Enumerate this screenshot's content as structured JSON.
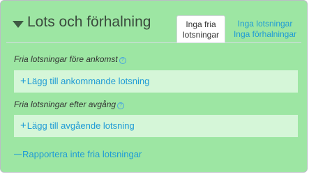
{
  "header": {
    "title": "Lots och förhalning",
    "tabs": [
      {
        "label_line1": "Inga fria",
        "label_line2": "lotsningar",
        "active": true
      },
      {
        "label_line1": "Inga lotsningar",
        "label_line2": "Inga förhalningar",
        "active": false
      }
    ]
  },
  "arrival": {
    "label": "Fria lotsningar före ankomst",
    "add_label": "Lägg till ankommande lotsning"
  },
  "departure": {
    "label": "Fria lotsningar efter avgång",
    "add_label": "Lägg till avgående lotsning"
  },
  "report_link": "Rapportera inte fria lotsningar",
  "icons": {
    "caret": "caret-down-icon",
    "info": "info-icon",
    "plus": "plus-icon",
    "minus": "minus-icon"
  },
  "colors": {
    "panel_bg": "#9de6a3",
    "row_bg": "#d5f6d8",
    "link": "#1e9bd6",
    "title": "#3a4a3d"
  }
}
